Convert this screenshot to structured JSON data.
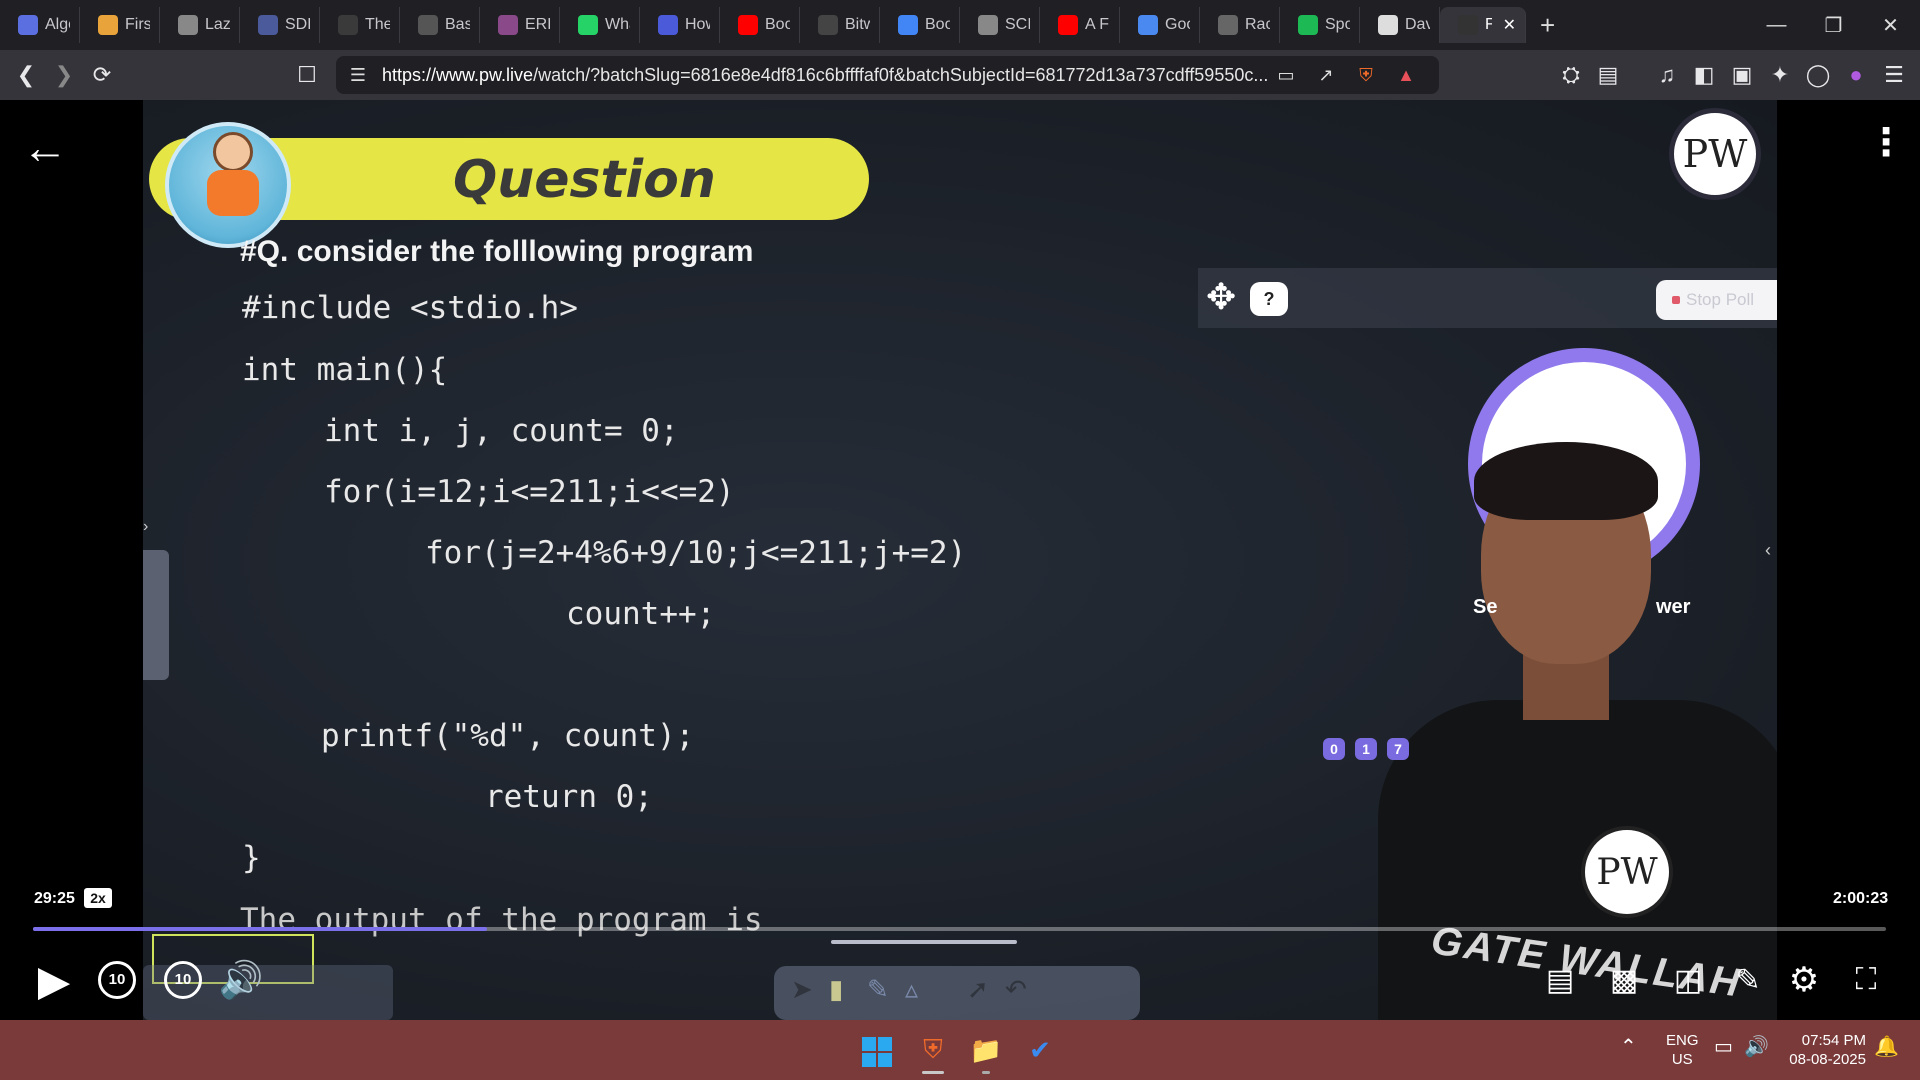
{
  "tabs": [
    {
      "label": "Algo",
      "icon": "copilot-icon",
      "color": "#5b6fe0"
    },
    {
      "label": "First",
      "icon": "pw-icon",
      "color": "#e8a33a"
    },
    {
      "label": "Lazy",
      "icon": "generic-site-icon",
      "color": "#888"
    },
    {
      "label": "SDL",
      "icon": "gfg-icon",
      "color": "#4a5a9a"
    },
    {
      "label": "The",
      "icon": "w3schools-icon",
      "color": "#3a3a3a"
    },
    {
      "label": "Basi",
      "icon": "site-icon",
      "color": "#555"
    },
    {
      "label": "ERR",
      "icon": "purple-site-icon",
      "color": "#8a4a8a"
    },
    {
      "label": "Wha",
      "icon": "whatsapp-icon",
      "color": "#25d366"
    },
    {
      "label": "How",
      "icon": "bookmark-icon",
      "color": "#4a5ad8"
    },
    {
      "label": "Boo",
      "icon": "youtube-icon",
      "color": "#ff0000"
    },
    {
      "label": "Bitw",
      "icon": "site-icon",
      "color": "#444"
    },
    {
      "label": "Boo",
      "icon": "google-icon",
      "color": "#4285f4"
    },
    {
      "label": "SCII",
      "icon": "generic-site-icon",
      "color": "#888"
    },
    {
      "label": "A Fi",
      "icon": "youtube-icon",
      "color": "#ff0000"
    },
    {
      "label": "Goo",
      "icon": "gemini-icon",
      "color": "#4a8af0"
    },
    {
      "label": "Rac",
      "icon": "chatgpt-icon",
      "color": "#666"
    },
    {
      "label": "Spo",
      "icon": "spotify-icon",
      "color": "#1db954"
    },
    {
      "label": "Dav",
      "icon": "wikipedia-icon",
      "color": "#ddd"
    },
    {
      "label": "F",
      "icon": "speaker-icon",
      "color": "#333",
      "active": true
    }
  ],
  "address": {
    "url_host": "https://www.pw.live",
    "url_rest": "/watch/?batchSlug=6816e8e4df816c6bffffaf0f&batchSubjectId=681772d13a737cdff59550c..."
  },
  "video": {
    "question_title": "Question",
    "question_line": "#Q. consider the folllowing program",
    "code": {
      "l1": "#include <stdio.h>",
      "l2": "int main(){",
      "l3": "int i, j, count= 0;",
      "l4": "for(i=12;i<=211;i<<=2)",
      "l5": "for(j=2+4%6+9/10;j<=211;j+=2)",
      "l6": "count++;",
      "l7": "printf(\"%d\", count);",
      "l8": "return 0;",
      "l9": "}",
      "l10": "The output of the program is"
    },
    "help_label": "?",
    "stop_poll_label": "Stop Poll",
    "side_left": "Se",
    "side_right": "wer",
    "poll_options": [
      "0",
      "1",
      "7"
    ],
    "logo_text": "PW",
    "gate_text": "GATE WALLAH"
  },
  "player": {
    "current_time": "29:25",
    "speed": "2x",
    "total_time": "2:00:23",
    "progress": 0.245,
    "rewind_label": "10",
    "forward_label": "10"
  },
  "taskbar": {
    "lang_top": "ENG",
    "lang_bottom": "US",
    "time": "07:54 PM",
    "date": "08-08-2025"
  }
}
